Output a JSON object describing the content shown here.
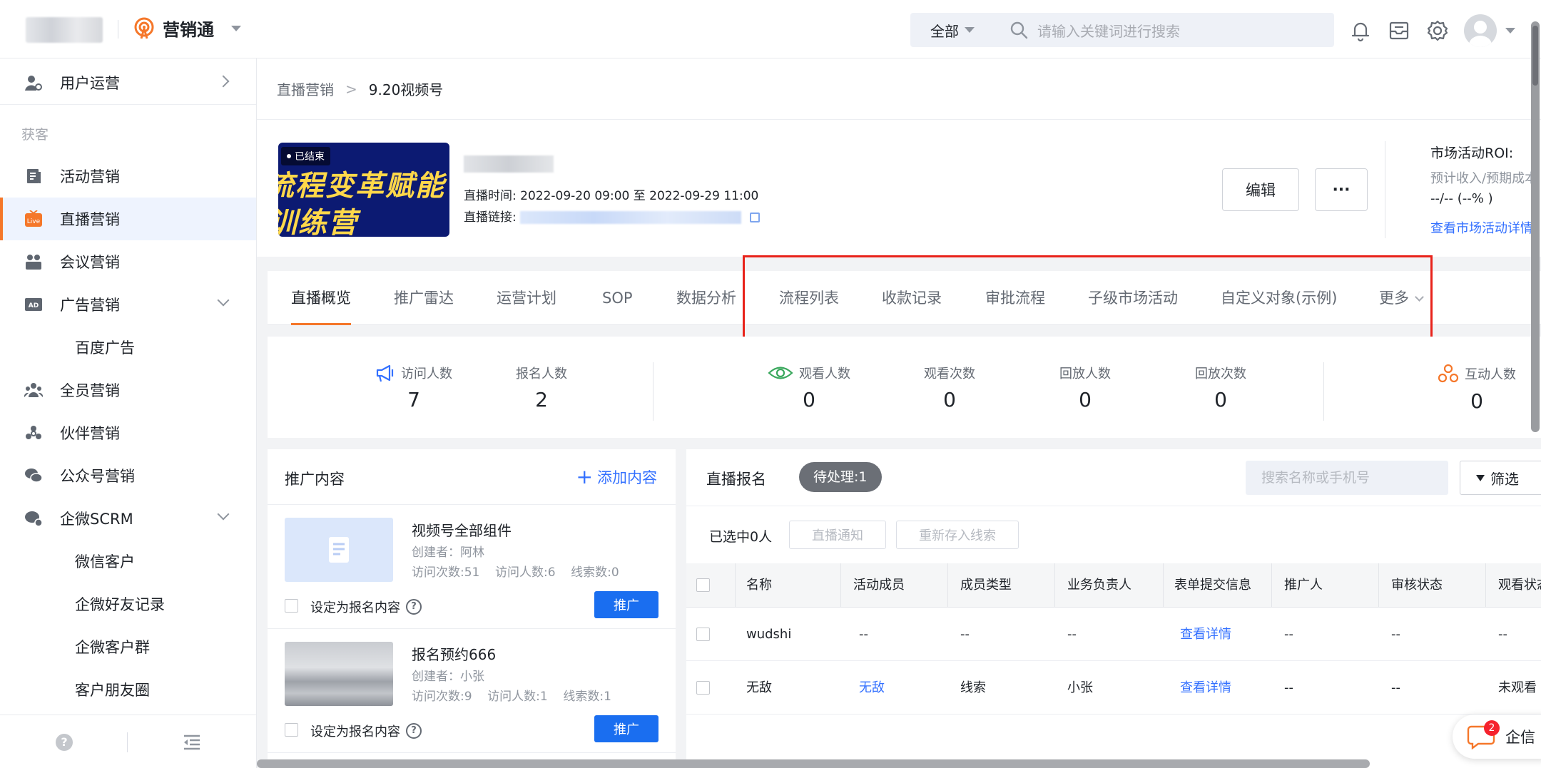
{
  "topbar": {
    "app_name": "营销通",
    "search_scope": "全部",
    "search_placeholder": "请输入关键词进行搜索"
  },
  "sidebar": {
    "top_item": "用户运营",
    "group_label": "获客",
    "items": [
      {
        "label": "活动营销",
        "icon": "activity-list-icon"
      },
      {
        "label": "直播营销",
        "icon": "live-icon",
        "active": true
      },
      {
        "label": "会议营销",
        "icon": "meeting-icon"
      },
      {
        "label": "广告营销",
        "icon": "ad-icon"
      },
      {
        "label": "百度广告"
      },
      {
        "label": "全员营销",
        "icon": "team-icon"
      },
      {
        "label": "伙伴营销",
        "icon": "partner-icon"
      },
      {
        "label": "公众号营销",
        "icon": "wechat-icon"
      },
      {
        "label": "企微SCRM",
        "icon": "scrm-icon"
      },
      {
        "label": "微信客户"
      },
      {
        "label": "企微好友记录"
      },
      {
        "label": "企微客户群"
      },
      {
        "label": "客户朋友圈"
      }
    ],
    "live_icon_text": "Live",
    "ad_icon_text": "AD",
    "help_glyph": "?"
  },
  "breadcrumb": {
    "parent": "直播营销",
    "separator": ">",
    "current": "9.20视频号"
  },
  "header": {
    "banner_line1": "流程变革赋能",
    "banner_line2": "训练营",
    "status_badge": "已结束",
    "time_label": "直播时间:",
    "time_value": "2022-09-20 09:00 至 2022-09-29 11:00",
    "link_label": "直播链接:",
    "edit_button": "编辑",
    "more_button": "···",
    "roi_title": "市场活动ROI:",
    "roi_sub": "预计收入/预期成本",
    "roi_value": "--/-- (--% )",
    "roi_link": "查看市场活动详情"
  },
  "tabs": [
    "直播概览",
    "推广雷达",
    "运营计划",
    "SOP",
    "数据分析",
    "流程列表",
    "收款记录",
    "审批流程",
    "子级市场活动",
    "自定义对象(示例)",
    "更多"
  ],
  "stats": [
    {
      "label": "访问人数",
      "value": "7"
    },
    {
      "label": "报名人数",
      "value": "2"
    },
    {
      "label": "观看人数",
      "value": "0"
    },
    {
      "label": "观看次数",
      "value": "0"
    },
    {
      "label": "回放人数",
      "value": "0"
    },
    {
      "label": "回放次数",
      "value": "0"
    },
    {
      "label": "互动人数",
      "value": "0"
    }
  ],
  "promo": {
    "title": "推广内容",
    "add_label": "添加内容",
    "checkbox_label": "设定为报名内容",
    "promote_button": "推广",
    "items": [
      {
        "name": "视频号全部组件",
        "creator": "创建者：阿林",
        "visits": "访问次数:51",
        "visitors": "访问人数:6",
        "leads": "线索数:0"
      },
      {
        "name": "报名预约666",
        "creator": "创建者：小张",
        "visits": "访问次数:9",
        "visitors": "访问人数:1",
        "leads": "线索数:1"
      }
    ]
  },
  "registration": {
    "title": "直播报名",
    "pending": "待处理:1",
    "search_placeholder": "搜索名称或手机号",
    "filter": "筛选",
    "selected": "已选中0人",
    "notify_button": "直播通知",
    "resave_button": "重新存入线索",
    "columns": [
      "名称",
      "活动成员",
      "成员类型",
      "业务负责人",
      "表单提交信息",
      "推广人",
      "审核状态",
      "观看状态"
    ],
    "rows": [
      [
        "wudshi",
        "--",
        "--",
        "--",
        "查看详情",
        "--",
        "--",
        "--"
      ],
      [
        "无敌",
        "无敌",
        "线索",
        "小张",
        "查看详情",
        "--",
        "--",
        "未观看"
      ]
    ]
  },
  "chat": {
    "badge": "2",
    "label": "企信"
  },
  "colors": {
    "accent": "#f5772a",
    "primary": "#3370ff",
    "button_blue": "#1a6ef0",
    "highlight": "#e8221a"
  }
}
